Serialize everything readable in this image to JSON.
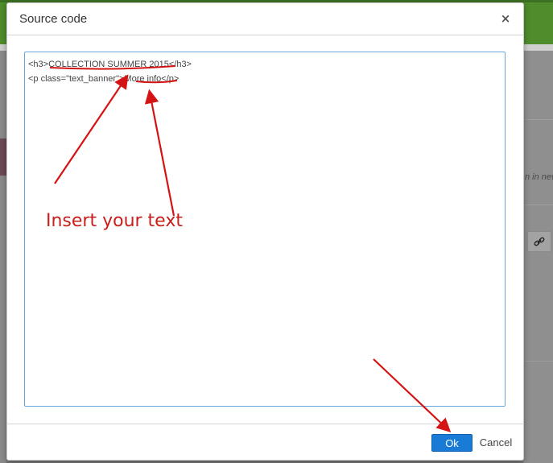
{
  "dialog": {
    "title": "Source code",
    "close_icon": "close-icon",
    "close_glyph": "×"
  },
  "editor": {
    "lines": [
      "<h3>COLLECTION SUMMER 2015</h3>",
      "<p class=\"text_banner\">More info</p>"
    ]
  },
  "footer": {
    "ok_label": "Ok",
    "cancel_label": "Cancel"
  },
  "annotation": {
    "text": "Insert your text",
    "color": "#c81e1e"
  },
  "background_page": {
    "italic_snippet": "n in new",
    "link_icon": "link-icon"
  },
  "colors": {
    "ok_button": "#1a7bd6",
    "editor_border": "#66a6d9",
    "topbar": "#4f8c2c"
  }
}
